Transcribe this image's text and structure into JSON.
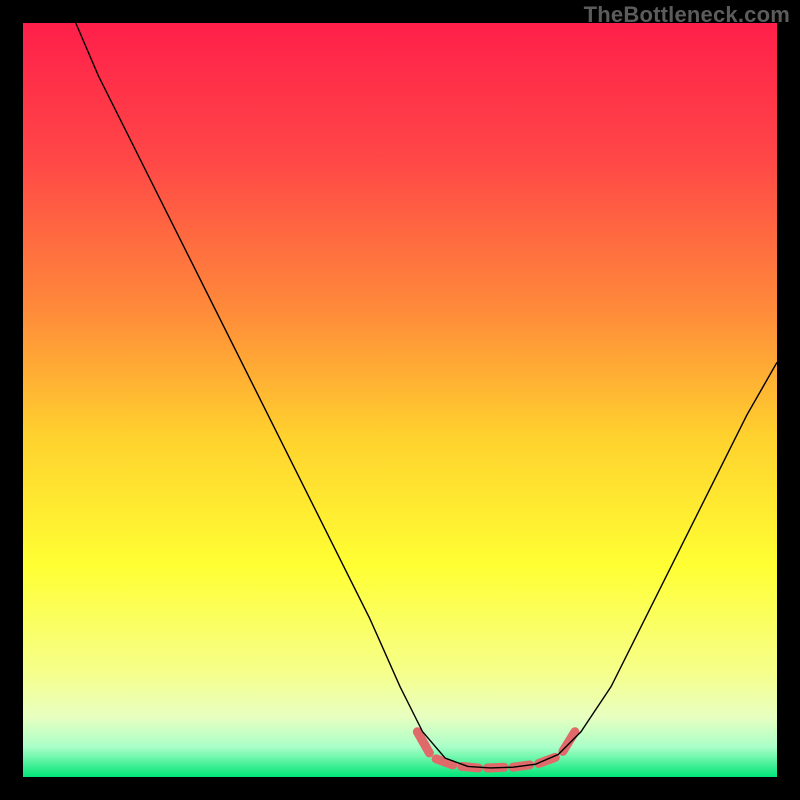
{
  "watermark": "TheBottleneck.com",
  "chart_data": {
    "type": "line",
    "title": "",
    "xlabel": "",
    "ylabel": "",
    "xlim": [
      0,
      100
    ],
    "ylim": [
      0,
      100
    ],
    "background_gradient": {
      "stops": [
        {
          "offset": 0,
          "color": "#ff1f4a"
        },
        {
          "offset": 18,
          "color": "#ff4747"
        },
        {
          "offset": 38,
          "color": "#ff8a3a"
        },
        {
          "offset": 55,
          "color": "#ffd22e"
        },
        {
          "offset": 72,
          "color": "#ffff33"
        },
        {
          "offset": 86,
          "color": "#f6ff8a"
        },
        {
          "offset": 92,
          "color": "#e8ffc0"
        },
        {
          "offset": 96,
          "color": "#aaffc8"
        },
        {
          "offset": 100,
          "color": "#00e677"
        }
      ]
    },
    "series": [
      {
        "name": "curve",
        "color": "#000000",
        "width": 1.4,
        "points": [
          {
            "x": 7.0,
            "y": 100.0
          },
          {
            "x": 10.0,
            "y": 93.0
          },
          {
            "x": 16.0,
            "y": 81.0
          },
          {
            "x": 22.0,
            "y": 69.0
          },
          {
            "x": 28.0,
            "y": 57.0
          },
          {
            "x": 34.0,
            "y": 45.0
          },
          {
            "x": 40.0,
            "y": 33.0
          },
          {
            "x": 46.0,
            "y": 21.0
          },
          {
            "x": 50.0,
            "y": 12.0
          },
          {
            "x": 53.0,
            "y": 6.0
          },
          {
            "x": 56.0,
            "y": 2.5
          },
          {
            "x": 59.0,
            "y": 1.4
          },
          {
            "x": 62.0,
            "y": 1.2
          },
          {
            "x": 65.0,
            "y": 1.3
          },
          {
            "x": 68.0,
            "y": 1.7
          },
          {
            "x": 71.0,
            "y": 3.0
          },
          {
            "x": 74.0,
            "y": 6.0
          },
          {
            "x": 78.0,
            "y": 12.0
          },
          {
            "x": 84.0,
            "y": 24.0
          },
          {
            "x": 90.0,
            "y": 36.0
          },
          {
            "x": 96.0,
            "y": 48.0
          },
          {
            "x": 100.0,
            "y": 55.0
          }
        ]
      },
      {
        "name": "highlight-dashes",
        "color": "#e06a6a",
        "width": 9,
        "segments": [
          {
            "x1": 52.3,
            "y1": 6.0,
            "x2": 53.9,
            "y2": 3.2
          },
          {
            "x1": 54.8,
            "y1": 2.4,
            "x2": 57.0,
            "y2": 1.6
          },
          {
            "x1": 58.2,
            "y1": 1.4,
            "x2": 60.4,
            "y2": 1.2
          },
          {
            "x1": 61.6,
            "y1": 1.2,
            "x2": 63.8,
            "y2": 1.3
          },
          {
            "x1": 65.0,
            "y1": 1.3,
            "x2": 67.2,
            "y2": 1.6
          },
          {
            "x1": 68.4,
            "y1": 1.8,
            "x2": 70.6,
            "y2": 2.6
          },
          {
            "x1": 71.6,
            "y1": 3.4,
            "x2": 73.2,
            "y2": 6.0
          }
        ]
      }
    ]
  }
}
